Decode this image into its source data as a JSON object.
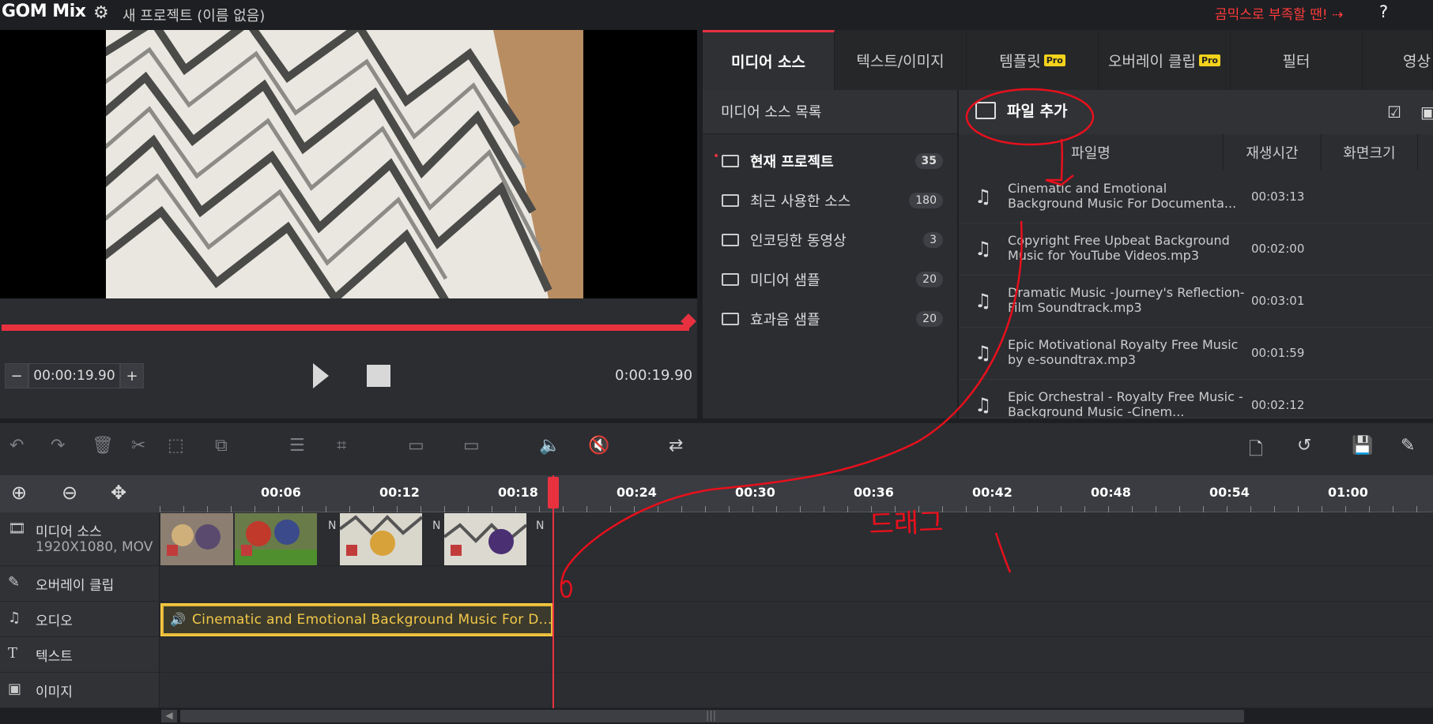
{
  "app": {
    "logo": "GOM Mix",
    "project_name": "새 프로젝트 (이름 없음)",
    "promo": "곰믹스로 부족할 땐! ⇢",
    "help": "?"
  },
  "player": {
    "timecode": "00:00:19.90",
    "duration": "0:00:19.90",
    "minus": "−",
    "plus": "+",
    "progress": 1.0
  },
  "tabs": [
    {
      "label": "미디어 소스",
      "pro": ""
    },
    {
      "label": "텍스트/이미지",
      "pro": ""
    },
    {
      "label": "템플릿",
      "pro": "Pro"
    },
    {
      "label": "오버레이 클립",
      "pro": "Pro"
    },
    {
      "label": "필터",
      "pro": ""
    },
    {
      "label": "영상",
      "pro": ""
    }
  ],
  "source_panel": {
    "title": "미디어 소스 목록",
    "items": [
      {
        "label": "현재 프로젝트",
        "count": "35"
      },
      {
        "label": "최근 사용한 소스",
        "count": "180"
      },
      {
        "label": "인코딩한 동영상",
        "count": "3"
      },
      {
        "label": "미디어 샘플",
        "count": "20"
      },
      {
        "label": "효과음 샘플",
        "count": "20"
      }
    ]
  },
  "file_panel": {
    "add_file": "파일 추가",
    "columns": [
      "파일명",
      "재생시간",
      "화면크기"
    ],
    "rows": [
      {
        "name": "Cinematic and Emotional Background Music For Documenta...",
        "duration": "00:03:13"
      },
      {
        "name": "Copyright Free Upbeat Background Music for YouTube Videos.mp3",
        "duration": "00:02:00"
      },
      {
        "name": "Dramatic Music -Journey's Reflection- Film Soundtrack.mp3",
        "duration": "00:03:01"
      },
      {
        "name": "Epic Motivational Royalty Free Music by e-soundtrax.mp3",
        "duration": "00:01:59"
      },
      {
        "name": "Epic Orchestral - Royalty Free Music - Background Music -Cinem...",
        "duration": "00:02:12"
      }
    ]
  },
  "ruler": [
    "00:06",
    "00:12",
    "00:18",
    "00:24",
    "00:30",
    "00:36",
    "00:42",
    "00:48",
    "00:54",
    "01:00"
  ],
  "tracks": {
    "media": {
      "label": "미디어 소스",
      "sub": "1920X1080, MOV"
    },
    "overlay": {
      "label": "오버레이 클립"
    },
    "audio": {
      "label": "오디오"
    },
    "text": {
      "label": "텍스트"
    },
    "image": {
      "label": "이미지"
    }
  },
  "transition_marks": [
    "N",
    "N",
    "N"
  ],
  "audio_clip": "Cinematic and Emotional Background Music For D...",
  "annotation_text": "드래그"
}
